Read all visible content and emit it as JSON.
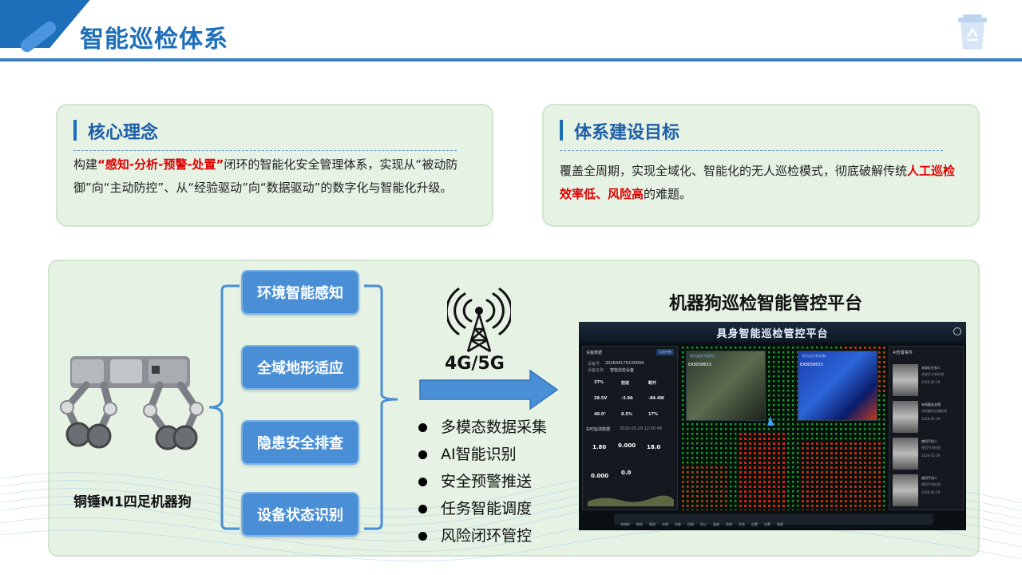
{
  "header": {
    "title": "智能巡检体系"
  },
  "core_concept": {
    "heading": "核心理念",
    "text_prefix": "构建",
    "highlight": "“感知-分析-预警-处置”",
    "text_rest": "闭环的智能化安全管理体系，实现从“被动防御”向“主动防控”、从“经验驱动”向“数据驱动”的数字化与智能化升级。"
  },
  "system_goal": {
    "heading": "体系建设目标",
    "text_prefix": "覆盖全周期，实现全域化、智能化的无人巡检模式，彻底破解传统",
    "highlight": "人工巡检效率低、风险高",
    "text_suffix": "的难题。"
  },
  "robot": {
    "label": "铜锤M1四足机器狗"
  },
  "functions": [
    "环境智能感知",
    "全域地形适应",
    "隐患安全排查",
    "设备状态识别"
  ],
  "network": {
    "label": "4G/5G",
    "icon": "signal-tower-icon"
  },
  "bullets": [
    "多模态数据采集",
    "AI智能识别",
    "安全预警推送",
    "任务智能调度",
    "风险闭环管控"
  ],
  "platform": {
    "title": "机器狗巡检智能管控平台",
    "dashboard": {
      "title": "具身智能巡检管控平台",
      "left_head": "设备数据",
      "left_btn": "远程控制",
      "device_no_label": "设备号",
      "device_no": "20260417D100099",
      "device_name_label": "设备名称",
      "device_name": "智能巡检设备",
      "stats_top": [
        "37%",
        "前进",
        "断开"
      ],
      "stats_mid": [
        "28.5V",
        "-3.0A",
        "-84.4W"
      ],
      "stats_bot": [
        "40.0°",
        "8.5%",
        "17%"
      ],
      "env_head": "实时监测数据",
      "env_time": "2026-05-29 12:50:48",
      "env_vals": [
        "1.80",
        "0.000",
        "18.0",
        "0.000",
        "0.0"
      ],
      "cam1_head": "双光云台(可见光)",
      "cam1_id": "EA8058653",
      "cam2_head": "双光云台(热成像)",
      "cam2_id": "EA8058653",
      "ai_head": "AI告警事件",
      "ai_items": [
        {
          "t1": "未穿反光衣人",
          "t2": "未穿反光衣检测",
          "t3": "2026-05-29"
        },
        {
          "t1": "未佩戴安全帽",
          "t2": "未佩戴安全帽检测",
          "t3": "2026-05-29"
        },
        {
          "t1": "使用手机人",
          "t2": "使用手机检测",
          "t3": "2026-05-29"
        },
        {
          "t1": "使用手机人",
          "t2": "使用手机检测",
          "t3": "2026-05-29"
        }
      ],
      "toolbar": [
        "充电桩",
        "前进",
        "倒退",
        "左移",
        "右移",
        "回收",
        "停止",
        "姿态",
        "导航",
        "任务",
        "设置",
        "告警",
        "地图"
      ]
    }
  }
}
